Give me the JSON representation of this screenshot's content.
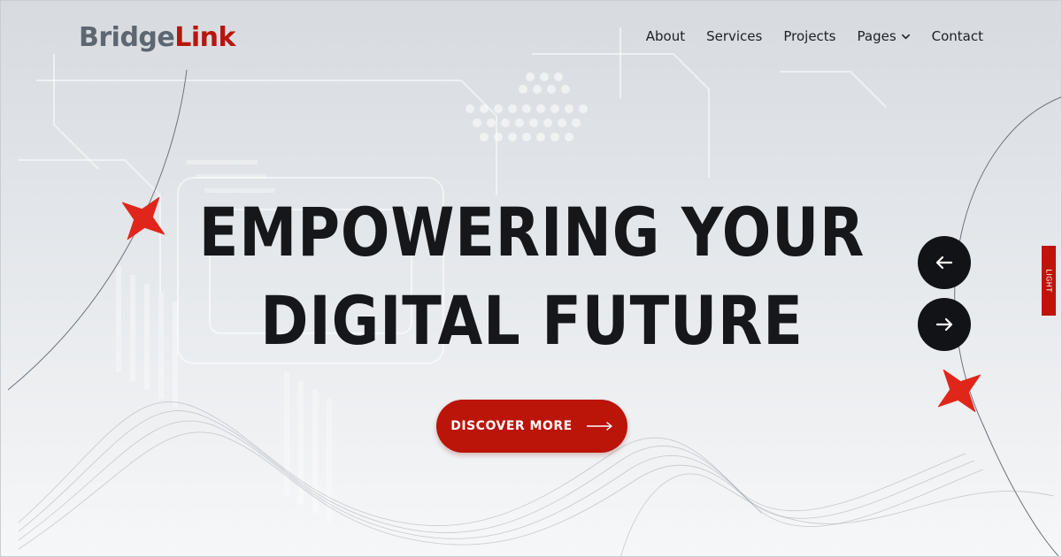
{
  "brand": {
    "part1": "Bridge",
    "part2": "Link"
  },
  "nav": {
    "items": [
      "About",
      "Services",
      "Projects",
      "Pages",
      "Contact"
    ]
  },
  "hero": {
    "line1": "EMPOWERING YOUR",
    "line2": "DIGITAL FUTURE",
    "cta_label": "DISCOVER MORE"
  },
  "theme_toggle": {
    "label": "LIGHT"
  },
  "icons": {
    "prev": "arrow-left-icon",
    "next": "arrow-right-icon",
    "cta": "long-arrow-right-icon",
    "pages": "chevron-down-icon",
    "decor": "four-point-star-icon"
  },
  "colors": {
    "brand_gray": "#5e6670",
    "accent_red": "#bb1409",
    "dark": "#121316",
    "background": "#e3e6ea"
  }
}
